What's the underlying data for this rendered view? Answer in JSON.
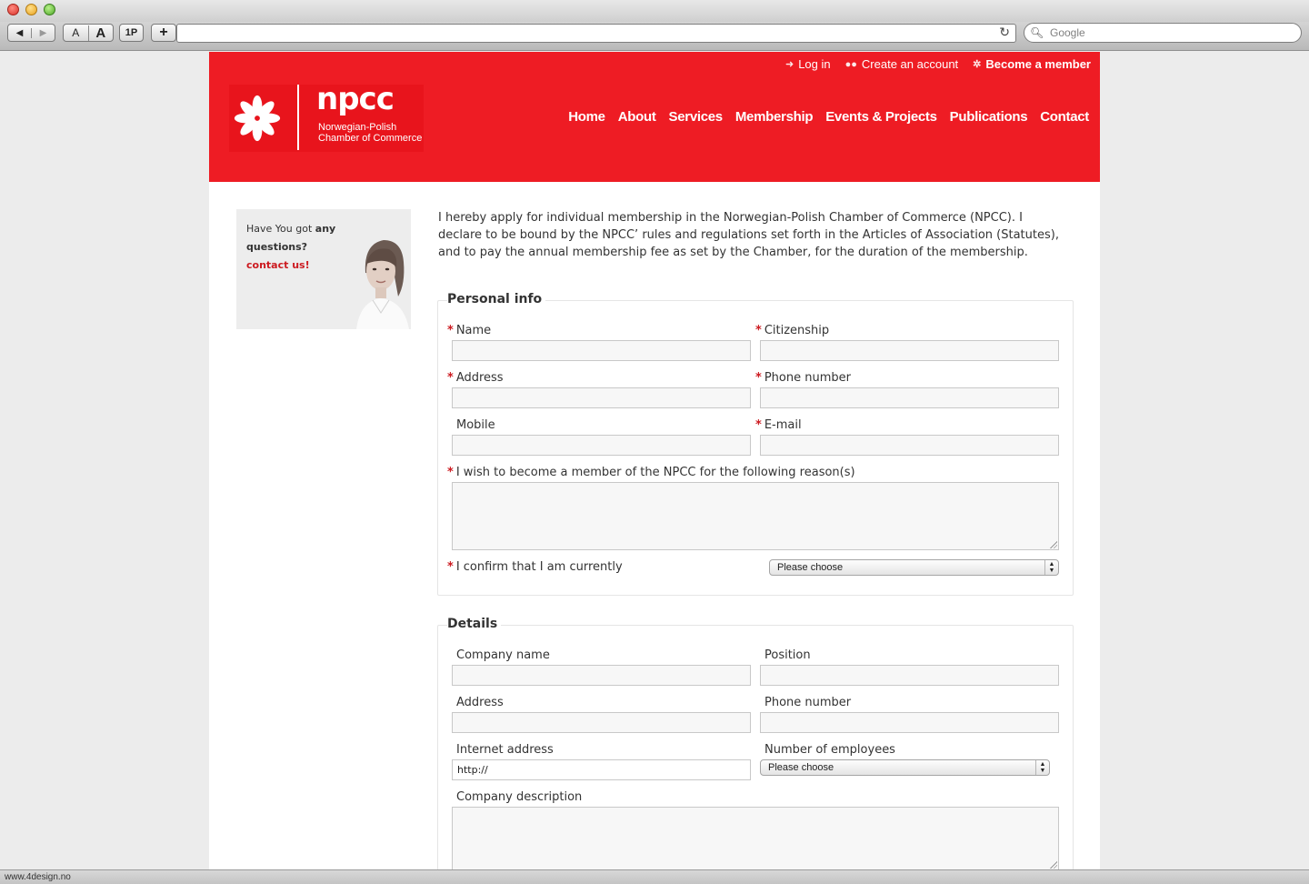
{
  "browser": {
    "nav_back": "◀",
    "nav_forward": "▶",
    "font_small": "A",
    "font_large": "A",
    "onepassword": "1P",
    "add_tab": "+",
    "search_placeholder": "Google",
    "status_url": "www.4design.no"
  },
  "site": {
    "brand_color": "#ee1c24",
    "top_links": [
      {
        "label": "Log in",
        "icon": "login-icon"
      },
      {
        "label": "Create an account",
        "icon": "users-icon"
      },
      {
        "label": "Become a member",
        "icon": "sparkle-icon"
      }
    ],
    "logo": {
      "word": "npcc",
      "sub1": "Norwegian-Polish",
      "sub2": "Chamber of Commerce"
    },
    "nav": [
      "Home",
      "About",
      "Services",
      "Membership",
      "Events & Projects",
      "Publications",
      "Contact"
    ]
  },
  "sidebar": {
    "q1": "Have You got ",
    "q1_bold": "any",
    "q2": "questions?",
    "contact": "contact us!"
  },
  "intro": "I hereby apply for individual membership in the Norwegian-Polish Chamber of Commerce (NPCC). I declare to be bound by the NPCC’ rules and regulations set forth in the Articles of Association (Statutes), and to pay the annual membership fee as set by the Chamber, for the duration of the membership.",
  "personal": {
    "legend": "Personal info",
    "req_mark": "*",
    "name": "Name",
    "citizenship": "Citizenship",
    "address": "Address",
    "phone": "Phone number",
    "mobile": "Mobile",
    "email": "E-mail",
    "reason": "I wish to become a member of the NPCC for the following reason(s)",
    "confirm": "I confirm that I am currently",
    "confirm_select": "Please choose"
  },
  "details": {
    "legend": "Details",
    "company": "Company name",
    "position": "Position",
    "address": "Address",
    "phone": "Phone number",
    "internet": "Internet address",
    "internet_value": "http://",
    "employees": "Number of employees",
    "employees_select": "Please choose",
    "description": "Company description"
  }
}
